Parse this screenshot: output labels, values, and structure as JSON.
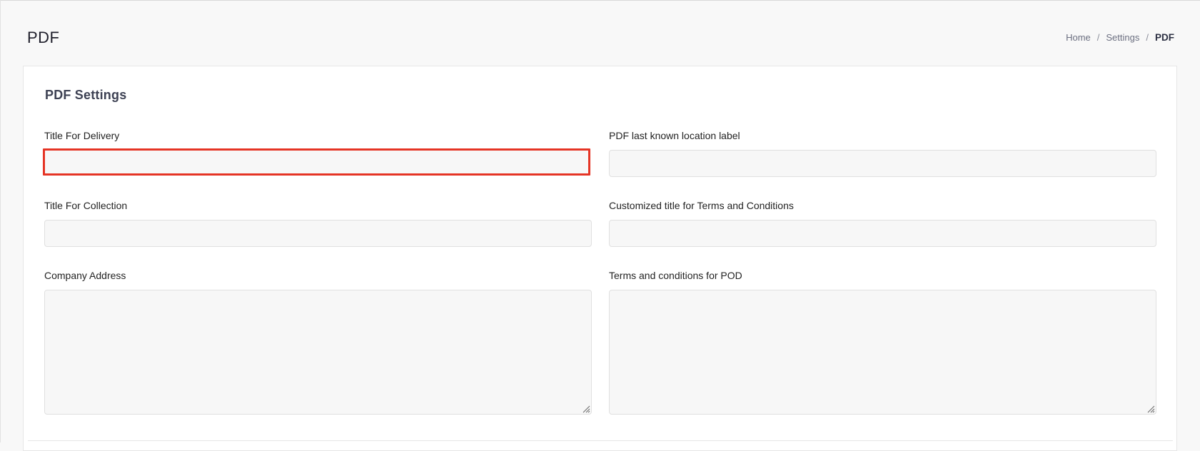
{
  "header": {
    "title": "PDF"
  },
  "breadcrumb": {
    "items": [
      "Home",
      "Settings"
    ],
    "separator": "/",
    "current": "PDF"
  },
  "card": {
    "title": "PDF Settings",
    "fields": {
      "title_for_delivery": {
        "label": "Title For Delivery",
        "value": "",
        "placeholder": ""
      },
      "pdf_last_known_location_label": {
        "label": "PDF last known location label",
        "value": "",
        "placeholder": ""
      },
      "title_for_collection": {
        "label": "Title For Collection",
        "value": "",
        "placeholder": ""
      },
      "customized_title_terms": {
        "label": "Customized title for Terms and Conditions",
        "value": "",
        "placeholder": ""
      },
      "company_address": {
        "label": "Company Address",
        "value": "",
        "placeholder": ""
      },
      "terms_for_pod": {
        "label": "Terms and conditions for POD",
        "value": "",
        "placeholder": ""
      }
    }
  },
  "colors": {
    "highlight": "#e53425",
    "background": "#f8f8f8",
    "card": "#ffffff",
    "input_bg": "#f7f7f7"
  }
}
